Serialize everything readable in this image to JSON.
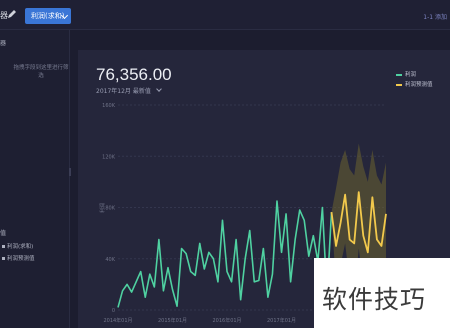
{
  "topbar": {
    "crumb": "器",
    "pill_label": "利润(求和)",
    "right_text": "1-1 添加"
  },
  "sidebar": {
    "section_title": "器",
    "hint": "拖拽字段到这里进行筛选",
    "section2_title": "值",
    "items": [
      {
        "label": "利润(求和)"
      },
      {
        "label": "利润预测值"
      }
    ]
  },
  "panel": {
    "value": "76,356.00",
    "subtitle": "2017年12月",
    "subtitle_mode": "最新值"
  },
  "legend": [
    {
      "name": "利润",
      "color": "#4fd1a1"
    },
    {
      "name": "利润预测值",
      "color": "#f2c94c"
    }
  ],
  "watermark": "软件技巧",
  "chart_data": {
    "type": "line",
    "ylabel": "利润",
    "ylim": [
      0,
      160000
    ],
    "yticks": [
      "0",
      "40K",
      "80K",
      "120K",
      "160K"
    ],
    "xticks": [
      "2014年01月",
      "2015年01月",
      "2016年01月",
      "2017年01月",
      "2018年01月"
    ],
    "x_range": [
      0,
      59
    ],
    "series": [
      {
        "name": "利润",
        "color": "#4fd1a1",
        "x": [
          0,
          1,
          2,
          3,
          4,
          5,
          6,
          7,
          8,
          9,
          10,
          11,
          12,
          13,
          14,
          15,
          16,
          17,
          18,
          19,
          20,
          21,
          22,
          23,
          24,
          25,
          26,
          27,
          28,
          29,
          30,
          31,
          32,
          33,
          34,
          35,
          36,
          37,
          38,
          39,
          40,
          41,
          42,
          43,
          44,
          45,
          46,
          47
        ],
        "values": [
          2000,
          15000,
          20000,
          14000,
          22000,
          30000,
          10000,
          28000,
          18000,
          55000,
          15000,
          33000,
          16000,
          3000,
          48000,
          44000,
          30000,
          27000,
          52000,
          32000,
          45000,
          40000,
          22000,
          70000,
          30000,
          22000,
          55000,
          8000,
          40000,
          62000,
          22000,
          23000,
          48000,
          10000,
          28000,
          85000,
          45000,
          75000,
          22000,
          55000,
          78000,
          70000,
          42000,
          58000,
          38000,
          80000,
          12000,
          76356
        ]
      },
      {
        "name": "利润预测值",
        "color": "#f2c94c",
        "x": [
          47,
          48,
          49,
          50,
          51,
          52,
          53,
          54,
          55,
          56,
          57,
          58,
          59
        ],
        "values": [
          76356,
          50000,
          68000,
          90000,
          55000,
          52000,
          92000,
          58000,
          45000,
          88000,
          55000,
          50000,
          75000
        ],
        "band_upper": [
          76356,
          95000,
          115000,
          125000,
          110000,
          105000,
          130000,
          112000,
          100000,
          125000,
          105000,
          98000,
          115000
        ],
        "band_lower": [
          76356,
          18000,
          35000,
          52000,
          22000,
          10000,
          48000,
          20000,
          5000,
          40000,
          15000,
          5000,
          30000
        ]
      }
    ]
  }
}
